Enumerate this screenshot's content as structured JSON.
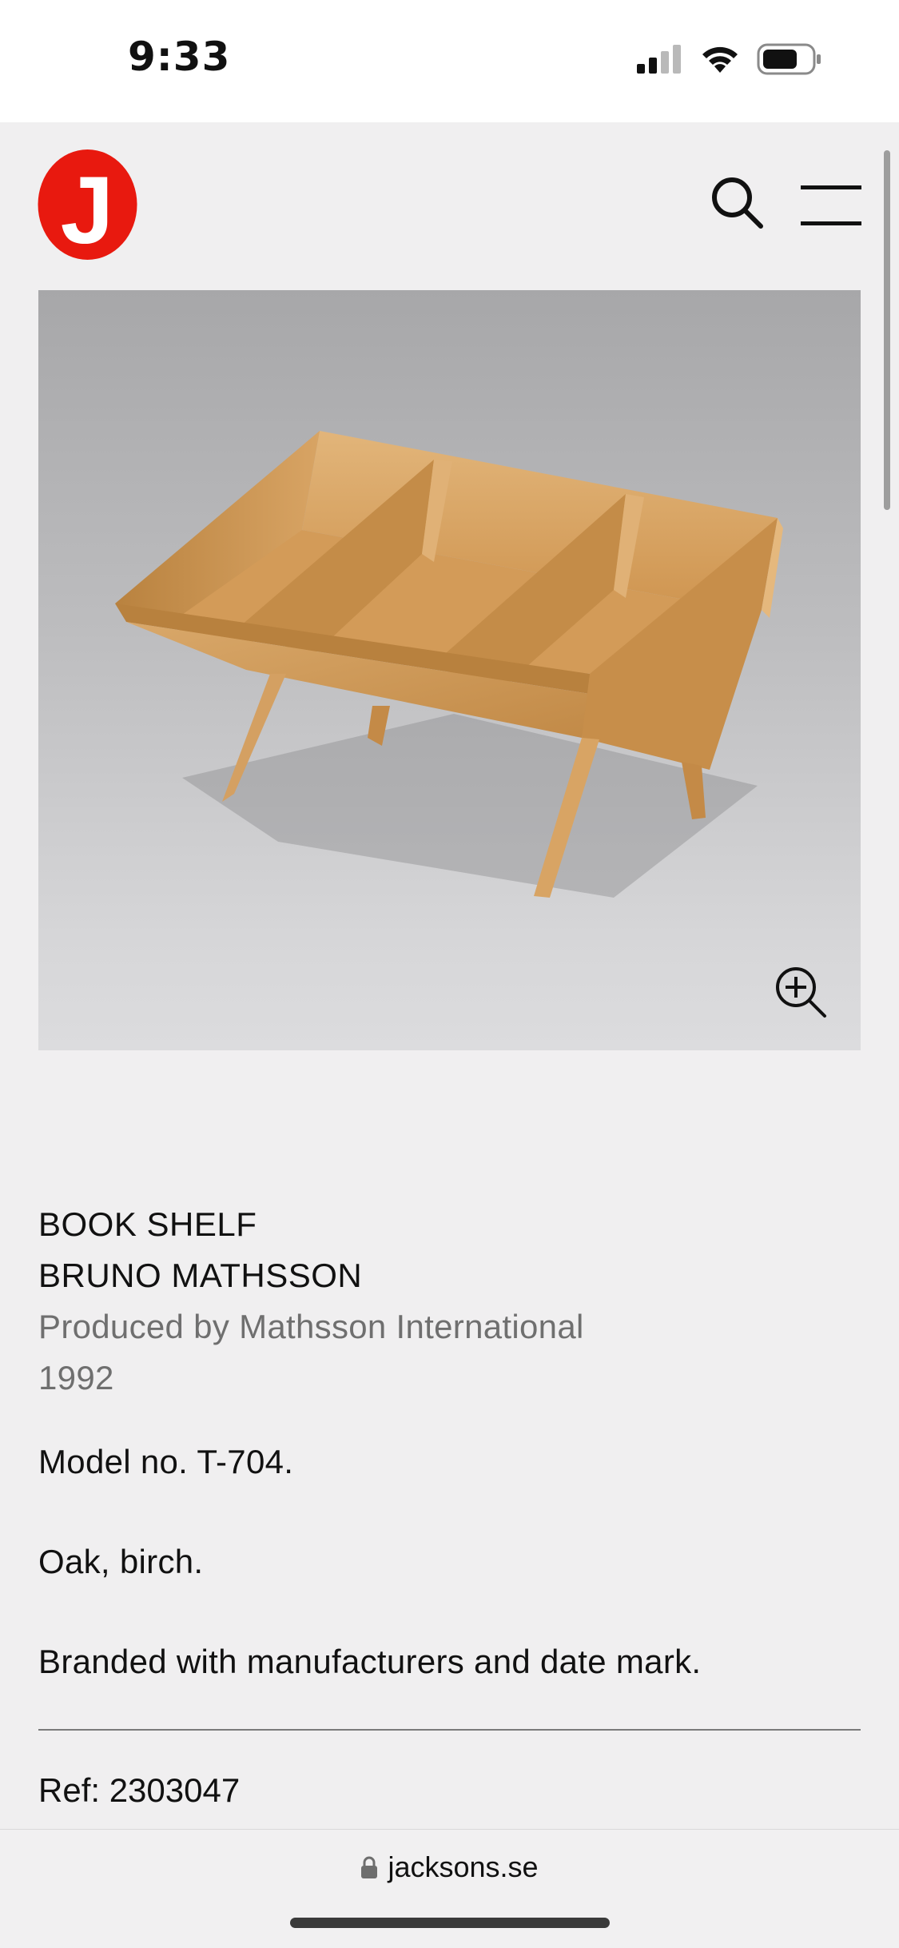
{
  "status_bar": {
    "time": "9:33"
  },
  "header": {
    "logo_letter": "J",
    "brand_color": "#e8190f"
  },
  "product": {
    "title": "BOOK SHELF",
    "designer": "BRUNO MATHSSON",
    "producer": "Produced by Mathsson International",
    "year": "1992",
    "model": "Model no. T-704.",
    "material": "Oak, birch.",
    "marking": "Branded with manufacturers and date mark.",
    "ref": "Ref: 2303047"
  },
  "browser": {
    "url": "jacksons.se"
  },
  "icons": {
    "search": "search-icon",
    "menu": "hamburger-menu-icon",
    "zoom": "zoom-in-icon",
    "lock": "lock-icon"
  }
}
